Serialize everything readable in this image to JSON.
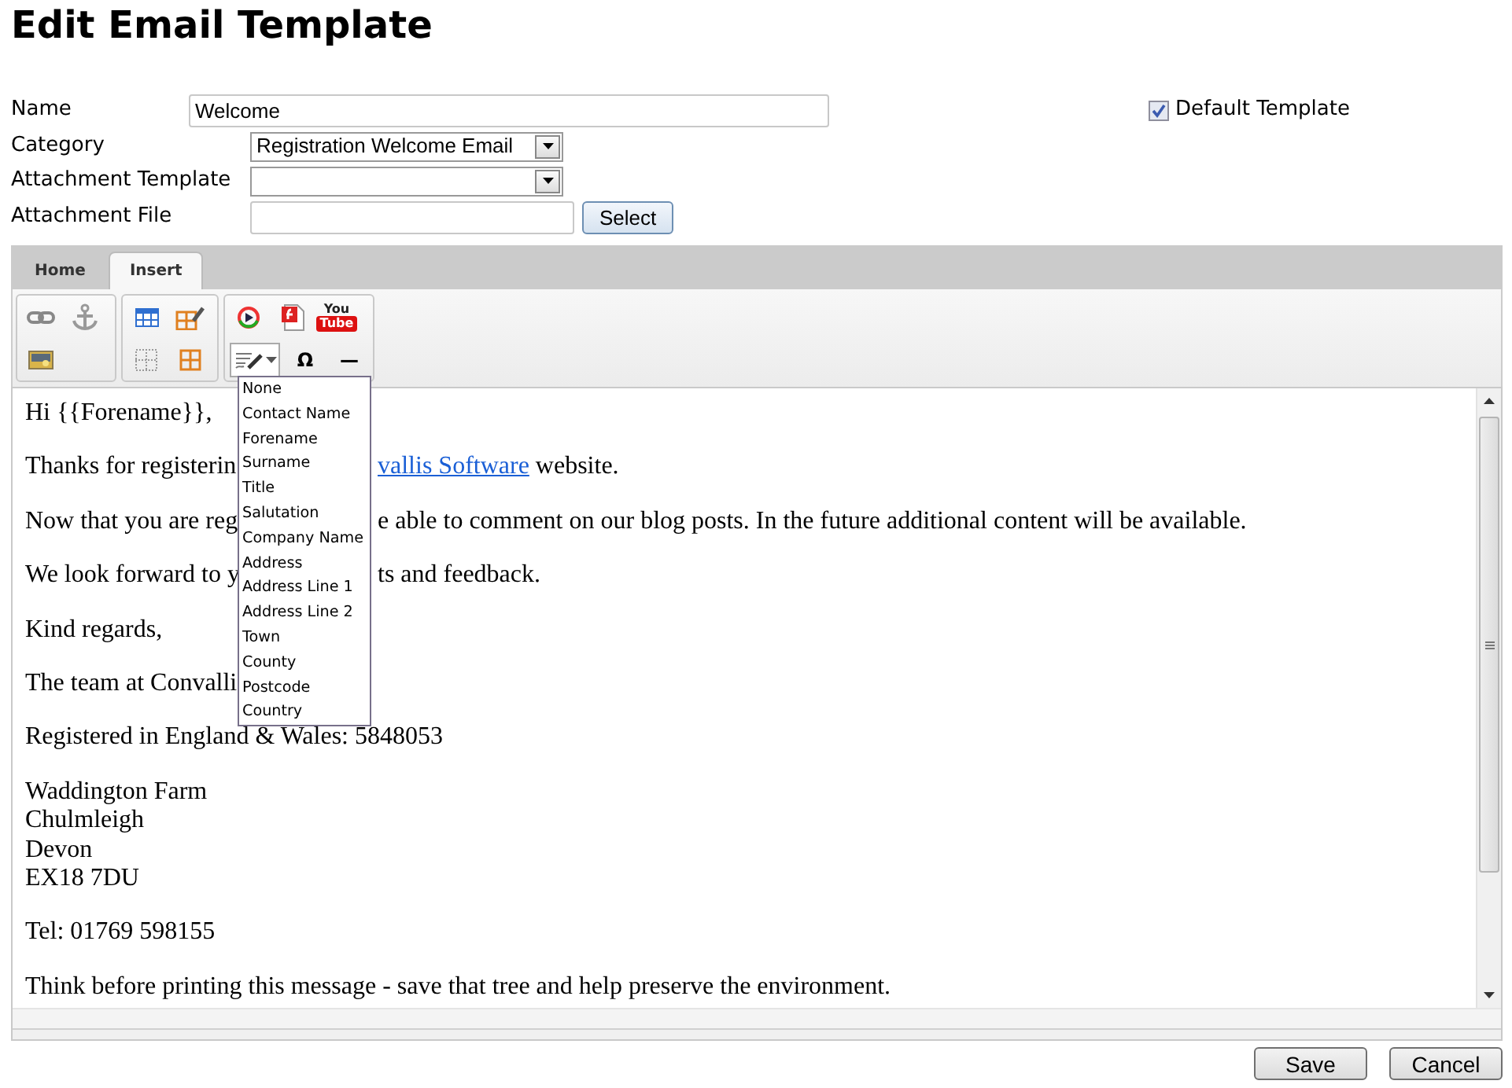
{
  "page_title": "Edit Email Template",
  "form": {
    "name": {
      "label": "Name",
      "value": "Welcome"
    },
    "category": {
      "label": "Category",
      "value": "Registration Welcome Email"
    },
    "attachment_template": {
      "label": "Attachment Template"
    },
    "attachment_file": {
      "label": "Attachment File",
      "button": "Select"
    },
    "default_template": {
      "label": "Default Template",
      "checked": true
    }
  },
  "editor": {
    "tabs": [
      {
        "label": "Home",
        "selected": false
      },
      {
        "label": "Insert",
        "selected": true
      }
    ],
    "video_logo": [
      "You",
      "Tube"
    ],
    "symbol_buttons": [
      "Ω",
      "—"
    ],
    "field_menu": {
      "expanded": true,
      "items": [
        "None",
        "Contact Name",
        "Forename",
        "Surname",
        "Title",
        "Salutation",
        "Company Name",
        "Address",
        "Address Line 1",
        "Address Line 2",
        "Town",
        "County",
        "Postcode",
        "Country"
      ]
    },
    "content": [
      {
        "kind": "text",
        "text": "Hi {{Forename}},"
      },
      {
        "kind": "split",
        "left": "Thanks for registerin",
        "link": "vallis Software",
        "right": "website."
      },
      {
        "kind": "split",
        "left": "Now that you are reg",
        "right": "e able to comment on our blog posts. In the future additional content will be available."
      },
      {
        "kind": "split",
        "left": "We look forward to y",
        "right": "ts and feedback."
      },
      {
        "kind": "text",
        "text": "Kind regards,"
      },
      {
        "kind": "text",
        "text": "The team at Convalli"
      },
      {
        "kind": "text",
        "text": "Registered in England & Wales: 5848053"
      },
      {
        "kind": "lines",
        "lines": [
          "Waddington Farm",
          "Chulmleigh",
          "Devon",
          "EX18 7DU"
        ]
      },
      {
        "kind": "text",
        "text": "Tel: 01769 598155"
      },
      {
        "kind": "footer",
        "text": "Think before printing this message - save that tree and help preserve the environment."
      }
    ]
  },
  "buttons": [
    "Save",
    "Cancel"
  ]
}
